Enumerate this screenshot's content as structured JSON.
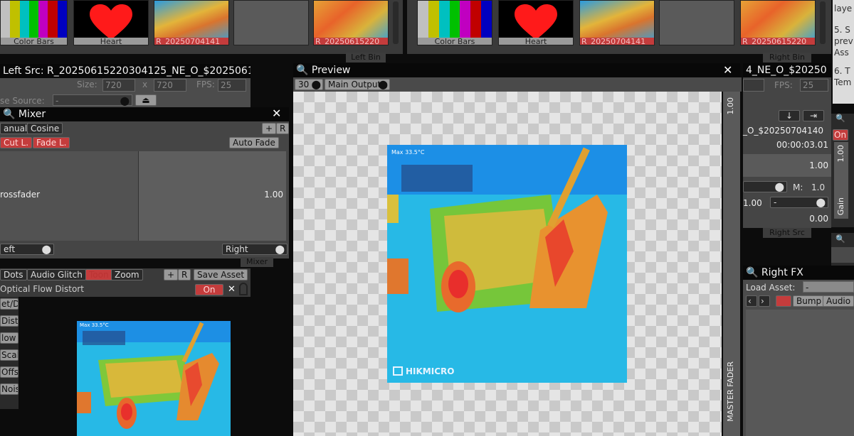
{
  "bins": {
    "left_bin_label": "Left Bin",
    "right_bin_label": "Right Bin",
    "thumbs": {
      "color_bars": "Color Bars",
      "heart": "Heart",
      "clip_a": "R_20250704141",
      "clip_b": "R_20250615220",
      "clip_c": "R_20250704141"
    }
  },
  "left_src": {
    "title": "Left Src: R_20250615220304125_NE_O_$2025061",
    "size_label": "Size:",
    "width": "720",
    "x_label": "x",
    "height": "720",
    "fps_label": "FPS:",
    "fps": "25",
    "source_label": "se Source:",
    "source_value": "-"
  },
  "mixer": {
    "title": "Mixer",
    "mode_manual": "anual",
    "mode_cosine": "Cosine",
    "cut_button": "Cut L.",
    "fade_button": "Fade L.",
    "auto_fade": "Auto Fade",
    "crossfader_label": "rossfader",
    "crossfader_value": "1.00",
    "left_select": "eft",
    "right_select": "Right",
    "tab_label": "Mixer",
    "plus": "+",
    "reset": "R"
  },
  "left_fx": {
    "tabs": [
      "Dots",
      "Audio Glitch",
      "Toon",
      "Zoom"
    ],
    "plus": "+",
    "reset": "R",
    "save_asset": "Save Asset",
    "effect_name": "Optical Flow Distort",
    "on_label": "On",
    "params": [
      "et/Dr",
      "Disto",
      "low",
      "Scale",
      "Offse",
      "Noise"
    ],
    "overlay_text": "Max 33.5°C"
  },
  "preview": {
    "title": "Preview",
    "fps_select": "30",
    "output_select": "Main Output",
    "master_fader_label": "MASTER FADER",
    "master_value": "1.00",
    "image_overlay": "Max 33.5°C",
    "watermark": "HIKMICRO"
  },
  "right_src": {
    "title_fragment": "4_NE_O_$20250",
    "fps_label": "FPS:",
    "fps": "25",
    "clip_name": "_O_$20250704140",
    "timecode": "00:00:03.01",
    "value_a": "1.00",
    "m_label": "M:",
    "m_value": "1.0",
    "speed": "1.00",
    "select_dash": "-",
    "value_zero": "0.00",
    "tab_label": "Right Src"
  },
  "gain": {
    "on_label": "On",
    "value": "1.00",
    "label": "Gain"
  },
  "right_fx": {
    "title": "Right FX",
    "load_asset_label": "Load Asset:",
    "load_asset_value": "-",
    "tabs": [
      "Bump",
      "Audio G"
    ]
  },
  "notes": {
    "line1": "laye",
    "line2": "5. S",
    "line3": "prev",
    "line4": "Ass",
    "line5": "6. T",
    "line6": "Tem"
  }
}
